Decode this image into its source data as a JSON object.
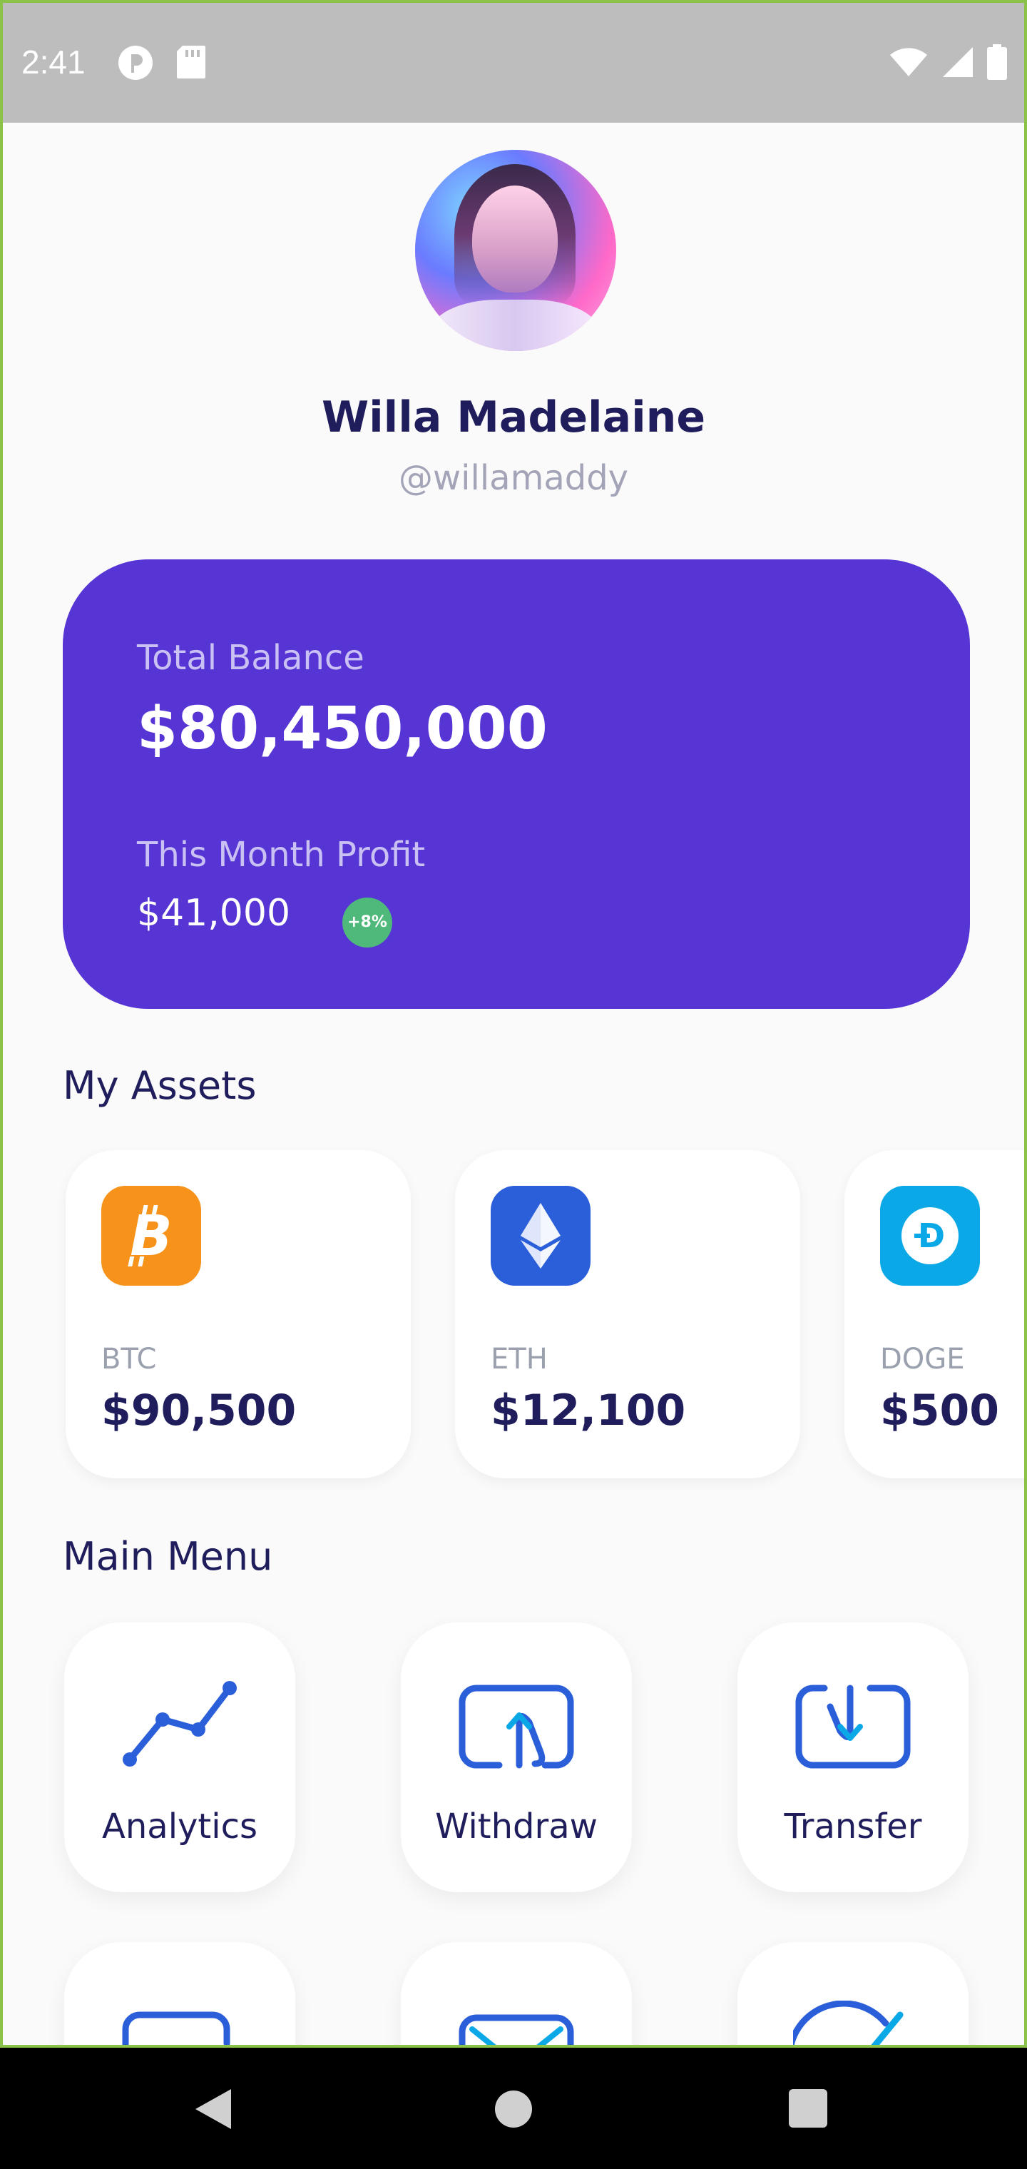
{
  "status_bar": {
    "time": "2:41",
    "icons": [
      "privacy-icon",
      "sd-card-icon",
      "wifi-icon",
      "signal-icon",
      "battery-icon"
    ]
  },
  "profile": {
    "name": "Willa Madelaine",
    "handle": "@willamaddy"
  },
  "balance": {
    "total_label": "Total Balance",
    "total_value": "$80,450,000",
    "profit_label": "This Month Profit",
    "profit_value": "$41,000",
    "profit_badge": "+8%"
  },
  "assets": {
    "title": "My Assets",
    "items": [
      {
        "symbol": "BTC",
        "value": "$90,500",
        "icon": "bitcoin-icon",
        "color": "#f7931a"
      },
      {
        "symbol": "ETH",
        "value": "$12,100",
        "icon": "ethereum-icon",
        "color": "#2b5fd9"
      },
      {
        "symbol": "DOGE",
        "value": "$500",
        "icon": "dogecoin-icon",
        "color": "#0aa8e6"
      }
    ]
  },
  "main_menu": {
    "title": "Main Menu",
    "items": [
      {
        "label": "Analytics",
        "icon": "analytics-icon"
      },
      {
        "label": "Withdraw",
        "icon": "withdraw-icon"
      },
      {
        "label": "Transfer",
        "icon": "transfer-icon"
      },
      {
        "label": "",
        "icon": "wallet-icon"
      },
      {
        "label": "",
        "icon": "mail-icon"
      },
      {
        "label": "",
        "icon": "check-icon"
      }
    ]
  },
  "colors": {
    "brand": "#5735d4",
    "text_primary": "#1f1d5c",
    "profit_badge": "#4fb97c",
    "icon_blue": "#2b5fd9"
  },
  "nav_bar": {
    "icons": [
      "back-icon",
      "home-icon",
      "recents-icon"
    ]
  }
}
